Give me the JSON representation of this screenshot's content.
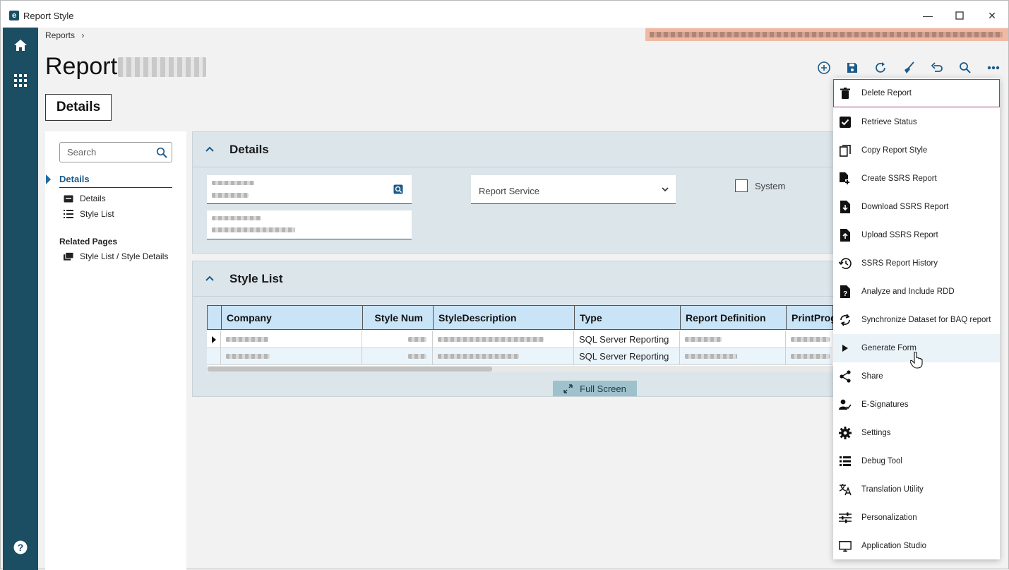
{
  "window": {
    "title": "Report Style",
    "logo_letter": "e",
    "minimize": "—",
    "close": "✕"
  },
  "breadcrumb": {
    "label": "Reports",
    "separator": "›"
  },
  "page": {
    "title": "Report"
  },
  "tabs": {
    "details": "Details"
  },
  "leftnav": {
    "search_placeholder": "Search",
    "section": "Details",
    "items": [
      {
        "label": "Details",
        "icon": "card-icon"
      },
      {
        "label": "Style List",
        "icon": "list-icon"
      }
    ],
    "related_heading": "Related Pages",
    "related_items": [
      {
        "label": "Style List / Style Details",
        "icon": "windows-icon"
      }
    ]
  },
  "details_panel": {
    "title": "Details",
    "report_service_label": "Report Service",
    "system_label": "System"
  },
  "style_list_panel": {
    "title": "Style List",
    "columns": [
      "Company",
      "Style Num",
      "StyleDescription",
      "Type",
      "Report Definition",
      "PrintProg"
    ],
    "rows": [
      {
        "type": "SQL Server Reporting"
      },
      {
        "type": "SQL Server Reporting"
      }
    ],
    "fullscreen_label": "Full Screen"
  },
  "menu": {
    "items": [
      {
        "label": "Delete Report",
        "icon": "trash-icon"
      },
      {
        "label": "Retrieve Status",
        "icon": "checkbox-icon"
      },
      {
        "label": "Copy Report Style",
        "icon": "copy-icon"
      },
      {
        "label": "Create SSRS Report",
        "icon": "file-add-icon"
      },
      {
        "label": "Download SSRS Report",
        "icon": "file-download-icon"
      },
      {
        "label": "Upload SSRS Report",
        "icon": "file-upload-icon"
      },
      {
        "label": "SSRS Report History",
        "icon": "history-icon"
      },
      {
        "label": "Analyze and Include RDD",
        "icon": "file-question-icon"
      },
      {
        "label": "Synchronize Dataset for BAQ report",
        "icon": "sync-icon"
      },
      {
        "label": "Generate Form",
        "icon": "play-icon"
      },
      {
        "label": "Share",
        "icon": "share-icon"
      },
      {
        "label": "E-Signatures",
        "icon": "esignature-icon"
      },
      {
        "label": "Settings",
        "icon": "gear-icon"
      },
      {
        "label": "Debug Tool",
        "icon": "debug-list-icon"
      },
      {
        "label": "Translation Utility",
        "icon": "translate-icon"
      },
      {
        "label": "Personalization",
        "icon": "sliders-icon"
      },
      {
        "label": "Application Studio",
        "icon": "monitor-icon"
      }
    ]
  },
  "colors": {
    "sidebar": "#1b4d63",
    "accent": "#1b5a8a",
    "panel": "#dbe5ea",
    "grid_header": "#c9e3f7",
    "banner": "#f1b9a4"
  }
}
